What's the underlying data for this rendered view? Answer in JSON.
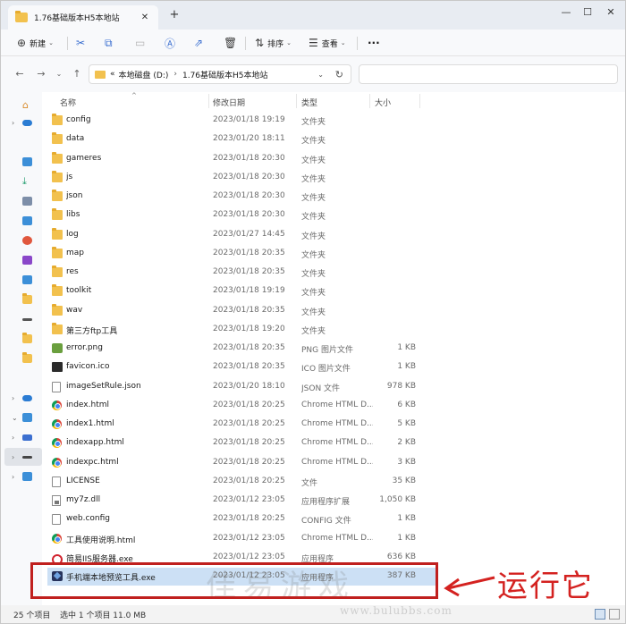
{
  "titlebar": {
    "tab_title": "1.76基础版本H5本地站",
    "tab_close": "✕",
    "new_tab": "+",
    "minimize": "—",
    "maximize": "☐",
    "close": "✕"
  },
  "toolbar": {
    "new_label": "新建",
    "sort_label": "排序",
    "view_label": "查看",
    "more_label": "···"
  },
  "address": {
    "overflow": "«",
    "crumbs": [
      "本地磁盘 (D:)",
      "1.76基础版本H5本地站"
    ],
    "search_placeholder": ""
  },
  "columns": {
    "name": "名称",
    "date": "修改日期",
    "type": "类型",
    "size": "大小"
  },
  "files": [
    {
      "name": "config",
      "date": "2023/01/18 19:19",
      "type": "文件夹",
      "size": "",
      "icon": "folder"
    },
    {
      "name": "data",
      "date": "2023/01/20 18:11",
      "type": "文件夹",
      "size": "",
      "icon": "folder"
    },
    {
      "name": "gameres",
      "date": "2023/01/18 20:30",
      "type": "文件夹",
      "size": "",
      "icon": "folder"
    },
    {
      "name": "js",
      "date": "2023/01/18 20:30",
      "type": "文件夹",
      "size": "",
      "icon": "folder"
    },
    {
      "name": "json",
      "date": "2023/01/18 20:30",
      "type": "文件夹",
      "size": "",
      "icon": "folder"
    },
    {
      "name": "libs",
      "date": "2023/01/18 20:30",
      "type": "文件夹",
      "size": "",
      "icon": "folder"
    },
    {
      "name": "log",
      "date": "2023/01/27 14:45",
      "type": "文件夹",
      "size": "",
      "icon": "folder"
    },
    {
      "name": "map",
      "date": "2023/01/18 20:35",
      "type": "文件夹",
      "size": "",
      "icon": "folder"
    },
    {
      "name": "res",
      "date": "2023/01/18 20:35",
      "type": "文件夹",
      "size": "",
      "icon": "folder"
    },
    {
      "name": "toolkit",
      "date": "2023/01/18 19:19",
      "type": "文件夹",
      "size": "",
      "icon": "folder"
    },
    {
      "name": "wav",
      "date": "2023/01/18 20:35",
      "type": "文件夹",
      "size": "",
      "icon": "folder"
    },
    {
      "name": "第三方ftp工具",
      "date": "2023/01/18 19:20",
      "type": "文件夹",
      "size": "",
      "icon": "folder"
    },
    {
      "name": "error.png",
      "date": "2023/01/18 20:35",
      "type": "PNG 图片文件",
      "size": "1 KB",
      "icon": "png"
    },
    {
      "name": "favicon.ico",
      "date": "2023/01/18 20:35",
      "type": "ICO 图片文件",
      "size": "1 KB",
      "icon": "ico"
    },
    {
      "name": "imageSetRule.json",
      "date": "2023/01/20 18:10",
      "type": "JSON 文件",
      "size": "978 KB",
      "icon": "doc"
    },
    {
      "name": "index.html",
      "date": "2023/01/18 20:25",
      "type": "Chrome HTML D...",
      "size": "6 KB",
      "icon": "chrome"
    },
    {
      "name": "index1.html",
      "date": "2023/01/18 20:25",
      "type": "Chrome HTML D...",
      "size": "5 KB",
      "icon": "chrome"
    },
    {
      "name": "indexapp.html",
      "date": "2023/01/18 20:25",
      "type": "Chrome HTML D...",
      "size": "2 KB",
      "icon": "chrome"
    },
    {
      "name": "indexpc.html",
      "date": "2023/01/18 20:25",
      "type": "Chrome HTML D...",
      "size": "3 KB",
      "icon": "chrome"
    },
    {
      "name": "LICENSE",
      "date": "2023/01/18 20:25",
      "type": "文件",
      "size": "35 KB",
      "icon": "doc"
    },
    {
      "name": "my7z.dll",
      "date": "2023/01/12 23:05",
      "type": "应用程序扩展",
      "size": "1,050 KB",
      "icon": "dll"
    },
    {
      "name": "web.config",
      "date": "2023/01/18 20:25",
      "type": "CONFIG 文件",
      "size": "1 KB",
      "icon": "doc"
    },
    {
      "name": "工具使用说明.html",
      "date": "2023/01/12 23:05",
      "type": "Chrome HTML D...",
      "size": "1 KB",
      "icon": "chrome"
    },
    {
      "name": "简易IIS服务器.exe",
      "date": "2023/01/12 23:05",
      "type": "应用程序",
      "size": "636 KB",
      "icon": "iis"
    },
    {
      "name": "手机端本地预览工具.exe",
      "date": "2023/01/12 23:05",
      "type": "应用程序",
      "size": "387 KB",
      "icon": "exe",
      "selected": true
    }
  ],
  "status": {
    "item_count": "25 个项目",
    "selection": "选中 1 个项目  11.0 MB"
  },
  "annotation": {
    "label": "运行它"
  },
  "watermark": {
    "main": "佳易游戏",
    "sub": "www.bulubbs.com"
  },
  "colors": {
    "annotation_red": "#d42220",
    "selection_blue": "#cce0f5",
    "folder_yellow": "#f2c14e"
  }
}
